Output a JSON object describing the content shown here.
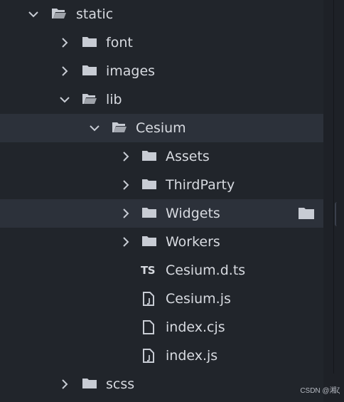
{
  "tree": {
    "items": [
      {
        "label": "static",
        "type": "folder",
        "expanded": true,
        "icon": "folder-open-icon"
      },
      {
        "label": "font",
        "type": "folder",
        "expanded": false,
        "icon": "folder-icon"
      },
      {
        "label": "images",
        "type": "folder",
        "expanded": false,
        "icon": "folder-icon"
      },
      {
        "label": "lib",
        "type": "folder",
        "expanded": true,
        "icon": "folder-open-icon"
      },
      {
        "label": "Cesium",
        "type": "folder",
        "expanded": true,
        "icon": "folder-open-icon",
        "selected": true
      },
      {
        "label": "Assets",
        "type": "folder",
        "expanded": false,
        "icon": "folder-icon"
      },
      {
        "label": "ThirdParty",
        "type": "folder",
        "expanded": false,
        "icon": "folder-icon"
      },
      {
        "label": "Widgets",
        "type": "folder",
        "expanded": false,
        "icon": "folder-icon",
        "hovered": true
      },
      {
        "label": "Workers",
        "type": "folder",
        "expanded": false,
        "icon": "folder-icon"
      },
      {
        "label": "Cesium.d.ts",
        "type": "file",
        "icon": "typescript-icon",
        "badge": "TS"
      },
      {
        "label": "Cesium.js",
        "type": "file",
        "icon": "js-file-icon"
      },
      {
        "label": "index.cjs",
        "type": "file",
        "icon": "file-icon"
      },
      {
        "label": "index.js",
        "type": "file",
        "icon": "js-file-icon"
      },
      {
        "label": "scss",
        "type": "folder",
        "expanded": false,
        "icon": "folder-icon"
      }
    ]
  },
  "watermark": "CSDN @湘ζ",
  "colors": {
    "background": "#21252b",
    "selected_row": "#2c313a",
    "text": "#d7dae0",
    "icon": "#c8ccd4"
  }
}
